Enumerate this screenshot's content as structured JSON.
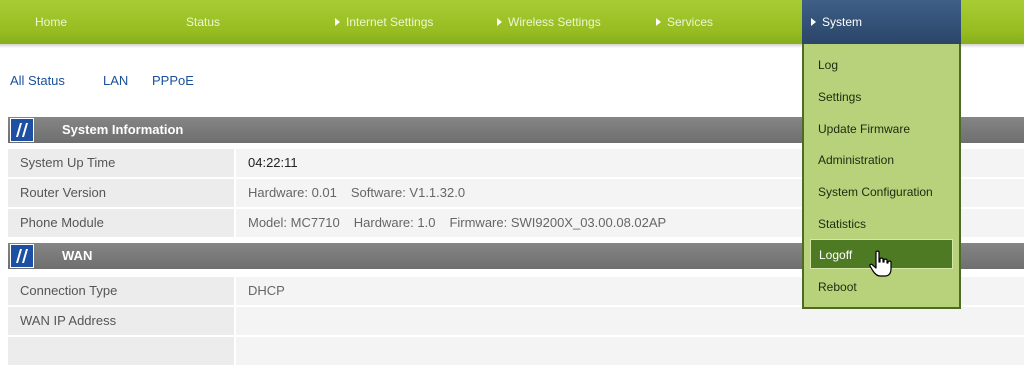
{
  "nav": {
    "home": "Home",
    "status": "Status",
    "internet_settings": "Internet Settings",
    "wireless_settings": "Wireless Settings",
    "services": "Services",
    "system": "System"
  },
  "sublinks": [
    "All Status",
    "LAN",
    "PPPoE"
  ],
  "system_info": {
    "title": "System Information",
    "uptime_label": "System Up Time",
    "uptime_value": "04:22:11",
    "router_label": "Router Version",
    "router_hw": "Hardware: 0.01",
    "router_sw": "Software: V1.1.32.0",
    "phone_label": "Phone Module",
    "phone_model": "Model: MC7710",
    "phone_hw": "Hardware: 1.0",
    "phone_fw": "Firmware: SWI9200X_03.00.08.02AP"
  },
  "wan": {
    "title": "WAN",
    "conn_label": "Connection Type",
    "conn_value": "DHCP",
    "ip_label": "WAN IP Address",
    "ip_value": ""
  },
  "system_menu": {
    "items": [
      "Log",
      "Settings",
      "Update Firmware",
      "Administration",
      "System Configuration",
      "Statistics",
      "Logoff",
      "Reboot"
    ],
    "active": "Logoff"
  },
  "colors": {
    "nav_green": "#97bd22",
    "nav_active_blue": "#2a4568",
    "section_gray": "#767676",
    "menu_bg": "#b7d27a",
    "menu_active": "#4f7a24",
    "link_blue": "#1a4f9c"
  },
  "icons": [
    "arrow-right-icon",
    "brand-logo-icon",
    "hand-pointer-cursor-icon"
  ]
}
